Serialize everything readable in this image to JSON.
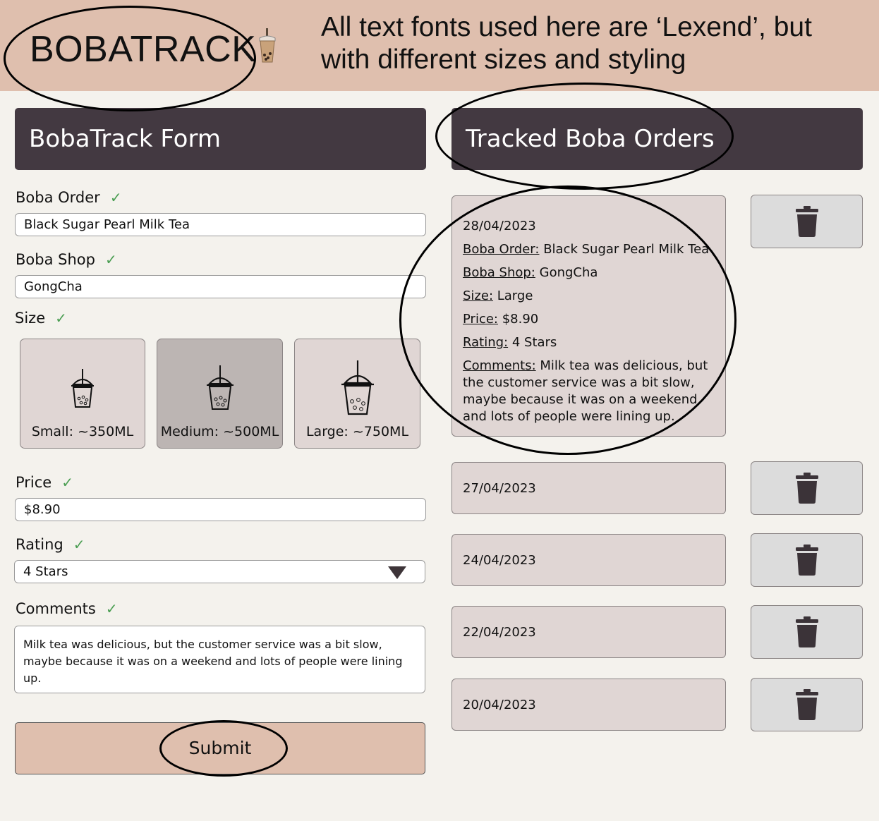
{
  "header": {
    "logo": "BOBATRACK",
    "note": "All text fonts used here are ‘Lexend’, but with different sizes and styling"
  },
  "form": {
    "title": "BobaTrack Form",
    "boba_order": {
      "label": "Boba Order",
      "value": "Black Sugar Pearl Milk Tea"
    },
    "boba_shop": {
      "label": "Boba Shop",
      "value": "GongCha"
    },
    "size": {
      "label": "Size",
      "options": [
        {
          "label": "Small: ~350ML"
        },
        {
          "label": "Medium: ~500ML"
        },
        {
          "label": "Large: ~750ML"
        }
      ],
      "selected": "Medium: ~500ML"
    },
    "price": {
      "label": "Price",
      "value": "$8.90"
    },
    "rating": {
      "label": "Rating",
      "value": "4 Stars"
    },
    "comments": {
      "label": "Comments",
      "value": "Milk tea was delicious, but the customer service was a bit slow, maybe because it was on a weekend and lots of people were lining up."
    },
    "submit_label": "Submit",
    "check_mark": "✓"
  },
  "orders": {
    "title": "Tracked Boba Orders",
    "expanded": {
      "date": "28/04/2023",
      "order_label": "Boba Order:",
      "order_value": "Black Sugar Pearl Milk Tea",
      "shop_label": "Boba Shop:",
      "shop_value": "GongCha",
      "size_label": "Size:",
      "size_value": "Large",
      "price_label": "Price:",
      "price_value": "$8.90",
      "rating_label": "Rating:",
      "rating_value": "4 Stars",
      "comments_label": "Comments:",
      "comments_value": "Milk tea was delicious, but the customer service was a bit slow, maybe because it was on a weekend and lots of people were lining up."
    },
    "collapsed_dates": [
      "27/04/2023",
      "24/04/2023",
      "22/04/2023",
      "20/04/2023"
    ]
  },
  "icons": {
    "trash": "trash-icon",
    "cup": "boba-cup-icon",
    "dropdown": "dropdown-arrow-icon"
  },
  "colors": {
    "header_bg": "#dfbfae",
    "panel_head_bg": "#433941",
    "card_bg": "#e0d6d4",
    "selected_bg": "#bcb5b3",
    "check": "#4a9e52",
    "page_bg": "#f4f2ed"
  }
}
